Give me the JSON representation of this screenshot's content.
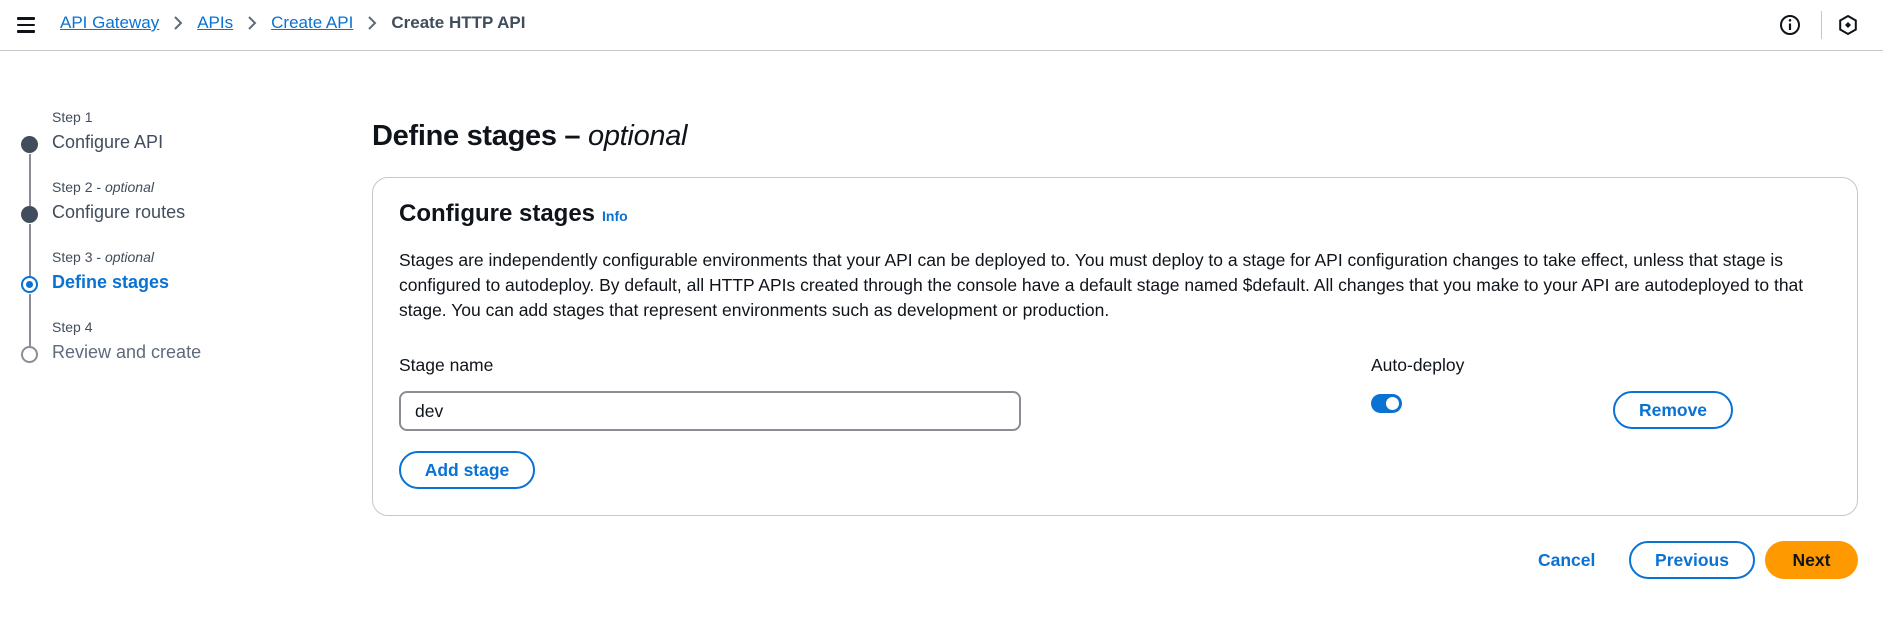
{
  "header": {
    "menu_icon": "hamburger-menu-icon",
    "breadcrumbs": [
      {
        "label": "API Gateway",
        "link": true
      },
      {
        "label": "APIs",
        "link": true
      },
      {
        "label": "Create API",
        "link": true
      },
      {
        "label": "Create HTTP API",
        "link": false
      }
    ],
    "right_icons": [
      "info-circle-icon",
      "notifications-settings-icon"
    ]
  },
  "steps": [
    {
      "label": "Step 1",
      "optional": "",
      "title": "Configure API",
      "state": "completed"
    },
    {
      "label": "Step 2",
      "optional": "optional",
      "title": "Configure routes",
      "state": "completed"
    },
    {
      "label": "Step 3",
      "optional": "optional",
      "title": "Define stages",
      "state": "active"
    },
    {
      "label": "Step 4",
      "optional": "",
      "title": "Review and create",
      "state": "upcoming"
    }
  ],
  "page": {
    "title": "Define stages",
    "title_suffix": "optional"
  },
  "card": {
    "title": "Configure stages",
    "info_link": "Info",
    "description": "Stages are independently configurable environments that your API can be deployed to. You must deploy to a stage for API configuration changes to take effect, unless that stage is configured to autodeploy. By default, all HTTP APIs created through the console have a default stage named $default. All changes that you make to your API are autodeployed to that stage. You can add stages that represent environments such as development or production.",
    "stage_name_label": "Stage name",
    "auto_deploy_label": "Auto-deploy",
    "stage_name_value": "dev",
    "auto_deploy_enabled": true,
    "remove_label": "Remove",
    "add_stage_label": "Add stage"
  },
  "footer": {
    "cancel_label": "Cancel",
    "previous_label": "Previous",
    "next_label": "Next"
  },
  "colors": {
    "accent": "#0972d3",
    "primary_button": "#ff9900",
    "text": "#0f141a"
  }
}
